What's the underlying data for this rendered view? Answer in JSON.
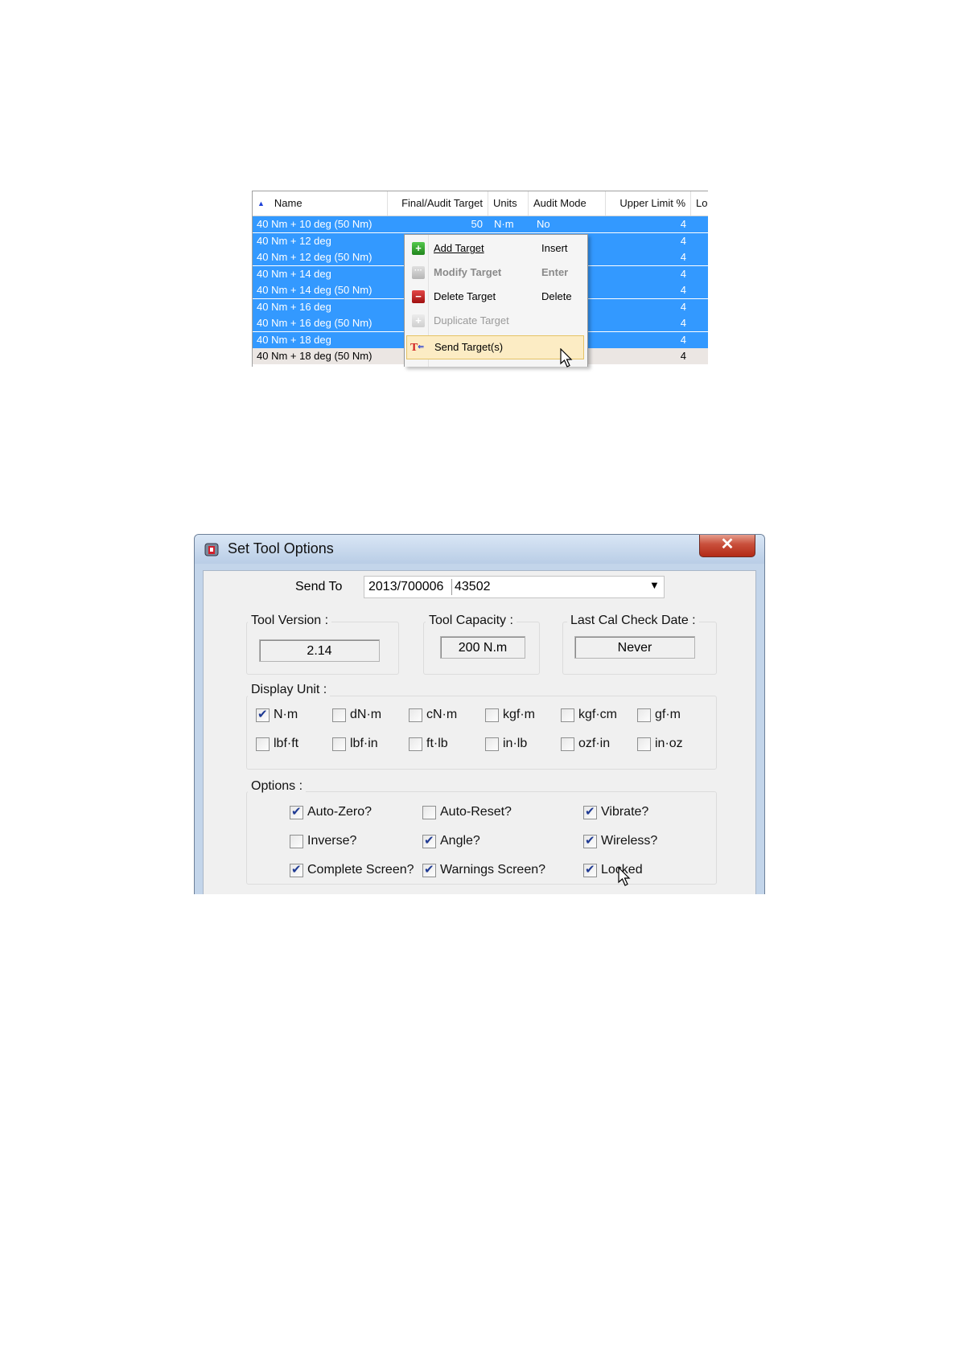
{
  "grid": {
    "columns": [
      {
        "label": "Name",
        "sorted": "ascending"
      },
      {
        "label": "Final/Audit Target"
      },
      {
        "label": "Units"
      },
      {
        "label": "Audit Mode"
      },
      {
        "label": "Upper Limit %"
      },
      {
        "label": "Lo"
      }
    ],
    "rows": [
      {
        "name": "40 Nm + 10 deg (50 Nm)",
        "target": "50",
        "units": "N·m",
        "audit": "No",
        "upper": "4",
        "selected": true
      },
      {
        "name": "40 Nm + 12 deg",
        "target": "",
        "units": "",
        "audit": "",
        "upper": "4",
        "selected": true
      },
      {
        "name": "40 Nm + 12 deg (50 Nm)",
        "target": "",
        "units": "",
        "audit": "",
        "upper": "4",
        "selected": true
      },
      {
        "name": "40 Nm + 14 deg",
        "target": "",
        "units": "",
        "audit": "",
        "upper": "4",
        "selected": true
      },
      {
        "name": "40 Nm + 14 deg (50 Nm)",
        "target": "",
        "units": "",
        "audit": "",
        "upper": "4",
        "selected": true
      },
      {
        "name": "40 Nm + 16 deg",
        "target": "",
        "units": "",
        "audit": "",
        "upper": "4",
        "selected": true
      },
      {
        "name": "40 Nm + 16 deg (50 Nm)",
        "target": "",
        "units": "",
        "audit": "",
        "upper": "4",
        "selected": true
      },
      {
        "name": "40 Nm + 18 deg",
        "target": "",
        "units": "",
        "audit": "",
        "upper": "4",
        "selected": true
      },
      {
        "name": "40 Nm + 18 deg (50 Nm)",
        "target": "",
        "units": "",
        "audit": "",
        "upper": "4",
        "selected": false
      }
    ]
  },
  "context_menu": {
    "items": [
      {
        "label": "Add Target",
        "shortcut": "Insert",
        "icon": "plus-icon",
        "state": "enabled"
      },
      {
        "label": "Modify Target",
        "shortcut": "Enter",
        "icon": "ellipsis-icon",
        "state": "default"
      },
      {
        "label": "Delete Target",
        "shortcut": "Delete",
        "icon": "minus-icon",
        "state": "enabled"
      },
      {
        "label": "Duplicate Target",
        "shortcut": "",
        "icon": "duplicate-icon",
        "state": "disabled"
      },
      {
        "label": "Send Target(s)",
        "shortcut": "",
        "icon": "send-target-icon",
        "state": "hover"
      }
    ]
  },
  "dialog": {
    "title": "Set Tool Options",
    "close_glyph": "✕",
    "send_to_label": "Send To",
    "send_to_serial": "2013/700006",
    "send_to_id": "43502",
    "tool_version_label": "Tool Version :",
    "tool_version": "2.14",
    "tool_capacity_label": "Tool Capacity :",
    "tool_capacity": "200 N.m",
    "last_cal_label": "Last Cal Check Date :",
    "last_cal": "Never",
    "display_unit_label": "Display Unit :",
    "units": [
      {
        "label": "N·m",
        "checked": true
      },
      {
        "label": "dN·m",
        "checked": false
      },
      {
        "label": "cN·m",
        "checked": false
      },
      {
        "label": "kgf·m",
        "checked": false
      },
      {
        "label": "kgf·cm",
        "checked": false
      },
      {
        "label": "gf·m",
        "checked": false
      },
      {
        "label": "lbf·ft",
        "checked": false
      },
      {
        "label": "lbf·in",
        "checked": false
      },
      {
        "label": "ft·lb",
        "checked": false
      },
      {
        "label": "in·lb",
        "checked": false
      },
      {
        "label": "ozf·in",
        "checked": false
      },
      {
        "label": "in·oz",
        "checked": false
      }
    ],
    "options_label": "Options :",
    "options": [
      {
        "label": "Auto-Zero?",
        "checked": true
      },
      {
        "label": "Auto-Reset?",
        "checked": false
      },
      {
        "label": "Vibrate?",
        "checked": true
      },
      {
        "label": "Inverse?",
        "checked": false
      },
      {
        "label": "Angle?",
        "checked": true
      },
      {
        "label": "Wireless?",
        "checked": true
      },
      {
        "label": "Complete Screen?",
        "checked": true
      },
      {
        "label": "Warnings Screen?",
        "checked": true
      },
      {
        "label": "Locked",
        "checked": true
      }
    ]
  },
  "colors": {
    "selection": "#3399ff",
    "menu_hover": "#fcecc4",
    "close_button": "#c9503c"
  }
}
